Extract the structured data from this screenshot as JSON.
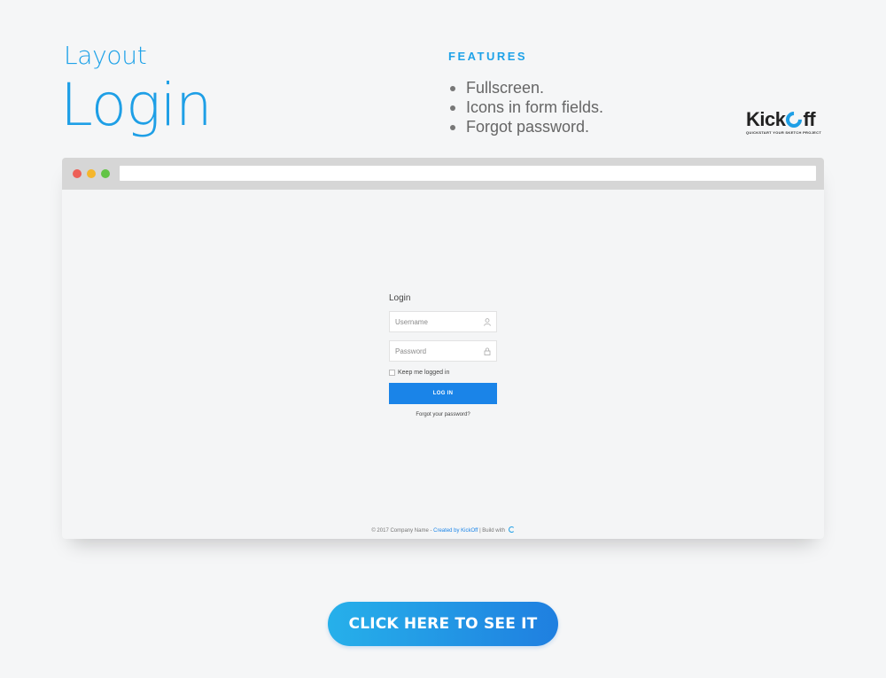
{
  "header": {
    "layout_label": "Layout",
    "title": "Login"
  },
  "features": {
    "heading": "FEATURES",
    "items": [
      "Fullscreen.",
      "Icons in form fields.",
      "Forgot password."
    ]
  },
  "brand": {
    "name_start": "Kick",
    "name_end": "ff",
    "tagline": "QUICKSTART YOUR SKETCH PROJECT",
    "accent_color": "#1e9fe6"
  },
  "browser_window": {
    "controls": [
      "close",
      "minimize",
      "maximize"
    ],
    "login_form": {
      "heading": "Login",
      "username_placeholder": "Username",
      "username_icon": "user-icon",
      "password_placeholder": "Password",
      "password_icon": "lock-icon",
      "remember_label": "Keep me logged in",
      "remember_checked": false,
      "submit_label": "LOG IN",
      "forgot_label": "Forgot your password?",
      "button_color": "#1a84e8"
    },
    "footer": {
      "copyright": "© 2017 Company Name -",
      "created_by": "Created by KickOff",
      "build_with": "| Build with"
    }
  },
  "cta": {
    "label": "CLICK HERE TO SEE IT"
  }
}
